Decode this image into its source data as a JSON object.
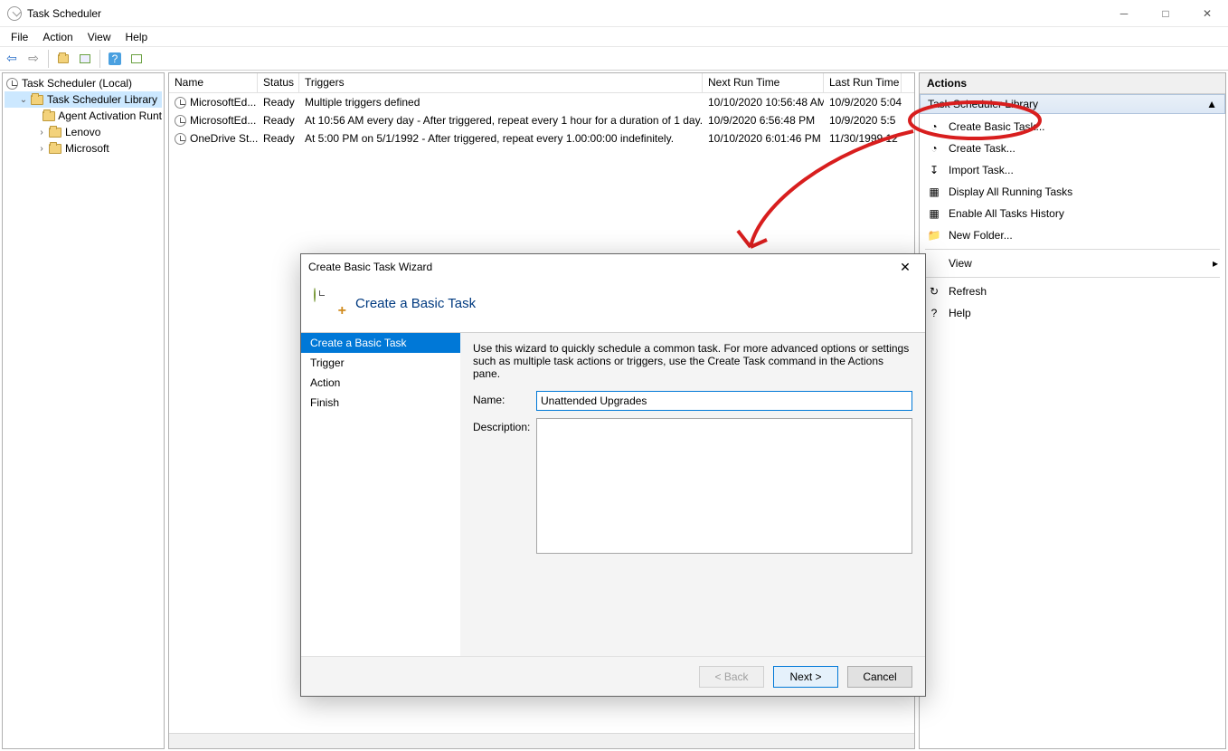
{
  "window": {
    "title": "Task Scheduler"
  },
  "menu": {
    "file": "File",
    "action": "Action",
    "view": "View",
    "help": "Help"
  },
  "tree": {
    "root": "Task Scheduler (Local)",
    "library": "Task Scheduler Library",
    "children": [
      "Agent Activation Runt",
      "Lenovo",
      "Microsoft"
    ]
  },
  "list": {
    "cols": {
      "name": "Name",
      "status": "Status",
      "triggers": "Triggers",
      "next": "Next Run Time",
      "last": "Last Run Time"
    },
    "rows": [
      {
        "name": "MicrosoftEd...",
        "status": "Ready",
        "triggers": "Multiple triggers defined",
        "next": "10/10/2020 10:56:48 AM",
        "last": "10/9/2020 5:04"
      },
      {
        "name": "MicrosoftEd...",
        "status": "Ready",
        "triggers": "At 10:56 AM every day - After triggered, repeat every 1 hour for a duration of 1 day.",
        "next": "10/9/2020 6:56:48 PM",
        "last": "10/9/2020 5:5"
      },
      {
        "name": "OneDrive St...",
        "status": "Ready",
        "triggers": "At 5:00 PM on 5/1/1992 - After triggered, repeat every 1.00:00:00 indefinitely.",
        "next": "10/10/2020 6:01:46 PM",
        "last": "11/30/1999 12"
      }
    ]
  },
  "actions": {
    "header": "Actions",
    "section": "Task Scheduler Library",
    "items": [
      "Create Basic Task...",
      "Create Task...",
      "Import Task...",
      "Display All Running Tasks",
      "Enable All Tasks History",
      "New Folder...",
      "View",
      "Refresh",
      "Help"
    ]
  },
  "dialog": {
    "title": "Create Basic Task Wizard",
    "heading": "Create a Basic Task",
    "intro": "Use this wizard to quickly schedule a common task.  For more advanced options or settings such as multiple task actions or triggers, use the Create Task command in the Actions pane.",
    "steps": [
      "Create a Basic Task",
      "Trigger",
      "Action",
      "Finish"
    ],
    "name_label": "Name:",
    "desc_label": "Description:",
    "name_value": "Unattended Upgrades",
    "back": "< Back",
    "next": "Next >",
    "cancel": "Cancel"
  }
}
